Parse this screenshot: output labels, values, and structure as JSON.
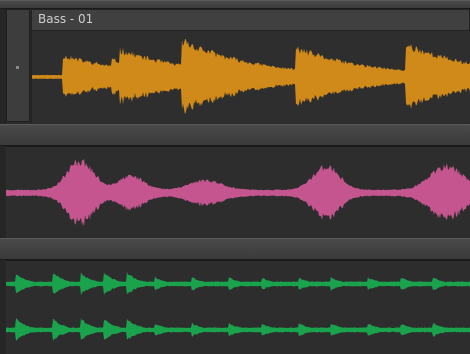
{
  "clip": {
    "title": "Bass - 01"
  },
  "colors": {
    "bass": "#d08a1a",
    "pink": "#c4558f",
    "green": "#1aa34c",
    "background": "#2b2b2b"
  },
  "tracks": [
    {
      "name": "bass-track",
      "color": "#d08a1a"
    },
    {
      "name": "pink-track",
      "color": "#c4558f"
    },
    {
      "name": "green-track-1",
      "color": "#1aa34c"
    },
    {
      "name": "green-track-2",
      "color": "#1aa34c"
    }
  ]
}
